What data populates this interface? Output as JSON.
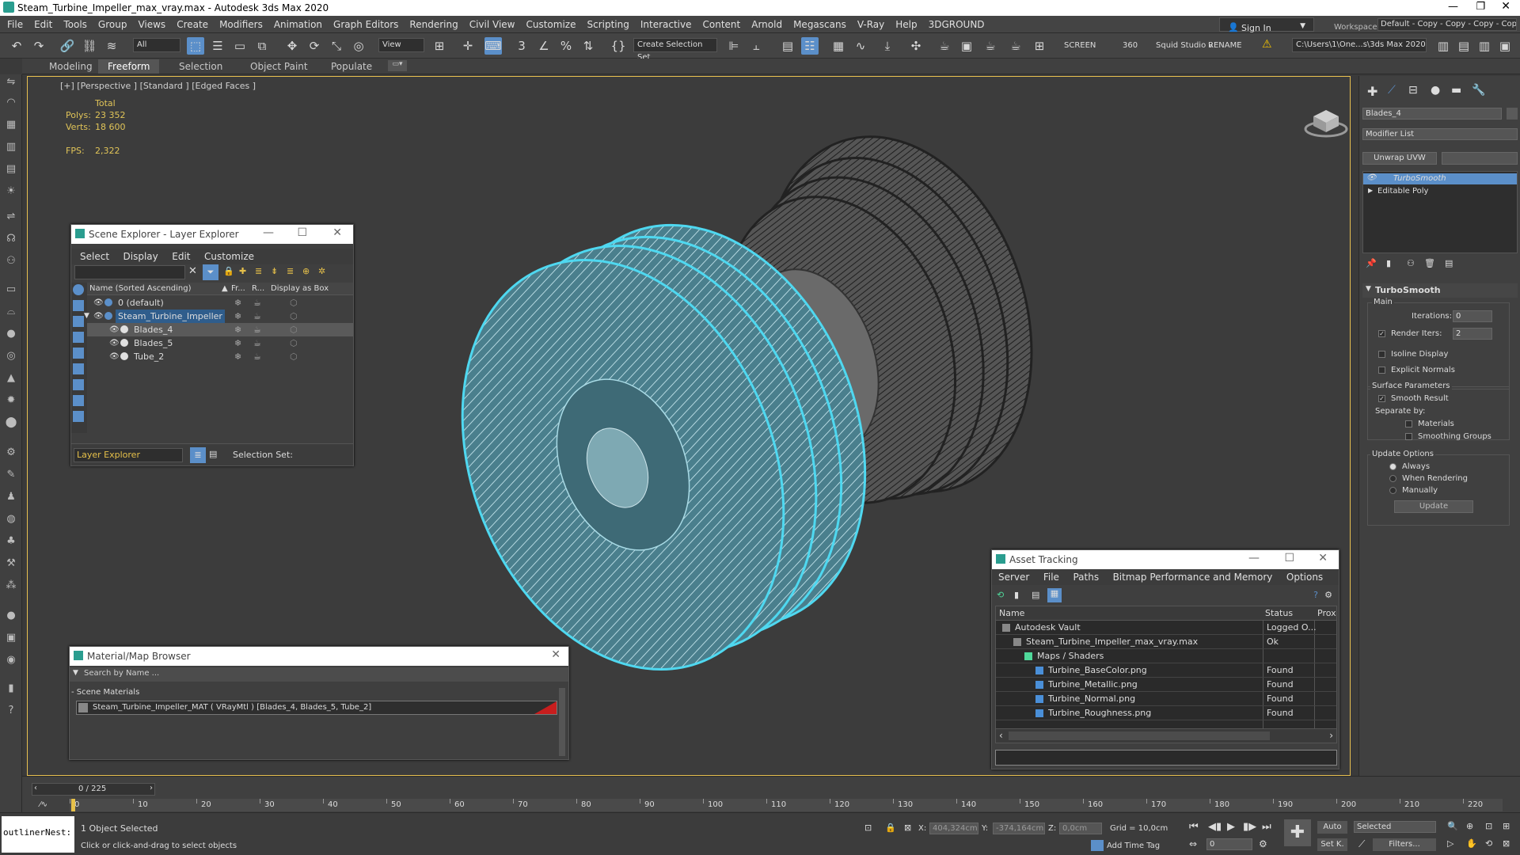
{
  "window": {
    "title": "Steam_Turbine_Impeller_max_vray.max - Autodesk 3ds Max 2020"
  },
  "menu": [
    "File",
    "Edit",
    "Tools",
    "Group",
    "Views",
    "Create",
    "Modifiers",
    "Animation",
    "Graph Editors",
    "Rendering",
    "Civil View",
    "Customize",
    "Scripting",
    "Interactive",
    "Content",
    "Arnold",
    "Megascans",
    "V-Ray",
    "Help",
    "3DGROUND"
  ],
  "signin": {
    "label": "Sign In"
  },
  "workspace": {
    "label": "Workspaces:",
    "value": "Default - Copy - Copy - Copy - Copy"
  },
  "toolbar": {
    "filter": "All",
    "view": "View",
    "selection_set": "Create Selection Set",
    "screen": "SCREEN",
    "angle": "360",
    "studio": "Squid Studio v",
    "rename": "RENAME",
    "path": "C:\\Users\\1\\One...s\\3ds Max 2020"
  },
  "ribbon": {
    "tabs": [
      "Modeling",
      "Freeform",
      "Selection",
      "Object Paint",
      "Populate"
    ],
    "active": "Freeform"
  },
  "viewport": {
    "label": "[+] [Perspective ] [Standard ] [Edged Faces ]",
    "stats": {
      "total_label": "Total",
      "polys_label": "Polys:",
      "polys": "23 352",
      "verts_label": "Verts:",
      "verts": "18 600",
      "fps_label": "FPS:",
      "fps": "2,322"
    }
  },
  "scene_explorer": {
    "title": "Scene Explorer - Layer Explorer",
    "menu": [
      "Select",
      "Display",
      "Edit",
      "Customize"
    ],
    "columns": [
      "Name (Sorted Ascending)",
      "Fr...",
      "R...",
      "Display as Box"
    ],
    "rows": [
      {
        "name": "0 (default)",
        "indent": 0
      },
      {
        "name": "Steam_Turbine_Impeller",
        "indent": 0,
        "highlight": "layer"
      },
      {
        "name": "Blades_4",
        "indent": 1,
        "highlight": "selected"
      },
      {
        "name": "Blades_5",
        "indent": 1
      },
      {
        "name": "Tube_2",
        "indent": 1
      }
    ],
    "footer_layer": "Layer Explorer",
    "footer_set": "Selection Set:"
  },
  "material_browser": {
    "title": "Material/Map Browser",
    "search_placeholder": "Search by Name ...",
    "section": "- Scene Materials",
    "item": "Steam_Turbine_Impeller_MAT  ( VRayMtl ) [Blades_4, Blades_5, Tube_2]"
  },
  "asset_tracking": {
    "title": "Asset Tracking",
    "menu": [
      "Server",
      "File",
      "Paths",
      "Bitmap Performance and Memory",
      "Options"
    ],
    "columns": [
      "Name",
      "Status",
      "Prox"
    ],
    "rows": [
      {
        "name": "Autodesk Vault",
        "status": "Logged O...",
        "indent": 0
      },
      {
        "name": "Steam_Turbine_Impeller_max_vray.max",
        "status": "Ok",
        "indent": 1
      },
      {
        "name": "Maps / Shaders",
        "status": "",
        "indent": 2
      },
      {
        "name": "Turbine_BaseColor.png",
        "status": "Found",
        "indent": 3
      },
      {
        "name": "Turbine_Metallic.png",
        "status": "Found",
        "indent": 3
      },
      {
        "name": "Turbine_Normal.png",
        "status": "Found",
        "indent": 3
      },
      {
        "name": "Turbine_Roughness.png",
        "status": "Found",
        "indent": 3
      }
    ]
  },
  "command_panel": {
    "object_name": "Blades_4",
    "modifier_list": "Modifier List",
    "unwrap_button": "Unwrap UVW",
    "stack": [
      "TurboSmooth",
      "Editable Poly"
    ],
    "rollout_title": "TurboSmooth",
    "main_label": "Main",
    "iterations_label": "Iterations:",
    "iterations": "0",
    "render_iters_label": "Render Iters:",
    "render_iters": "2",
    "isoline": "Isoline Display",
    "explicit": "Explicit Normals",
    "surface_params": "Surface Parameters",
    "smooth_result": "Smooth Result",
    "separate_by": "Separate by:",
    "materials": "Materials",
    "smoothing_groups": "Smoothing Groups",
    "update_options": "Update Options",
    "always": "Always",
    "when_rendering": "When Rendering",
    "manually": "Manually",
    "update_button": "Update"
  },
  "timeline": {
    "frame": "0 / 225",
    "ticks": [
      "0",
      "10",
      "20",
      "30",
      "40",
      "50",
      "60",
      "70",
      "80",
      "90",
      "100",
      "110",
      "120",
      "130",
      "140",
      "150",
      "160",
      "170",
      "180",
      "190",
      "200",
      "210",
      "220"
    ]
  },
  "status": {
    "script_label": "outlinerNest:",
    "selected": "1 Object Selected",
    "hint": "Click or click-and-drag to select objects",
    "x_label": "X:",
    "x": "404,324cm",
    "y_label": "Y:",
    "y": "-374,164cm",
    "z_label": "Z:",
    "z": "0,0cm",
    "grid": "Grid = 10,0cm",
    "add_time_tag": "Add Time Tag",
    "auto": "Auto",
    "selected_dd": "Selected",
    "set_key": "Set K.",
    "filters": "Filters...",
    "frame_value": "0"
  },
  "colors": {
    "accent": "#5b8fc9",
    "viewport_border": "#e8c050",
    "selection": "#4fd8f0",
    "stat": "#e0c458"
  }
}
